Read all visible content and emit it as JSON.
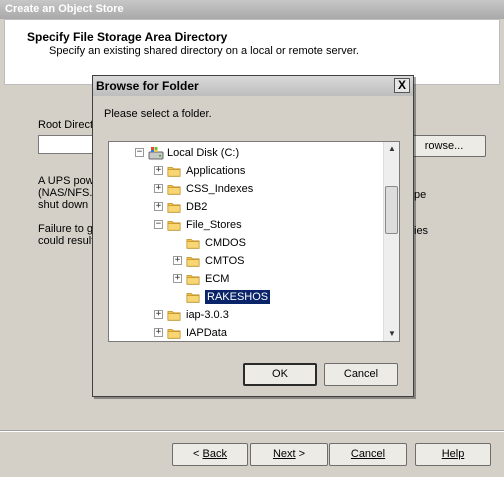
{
  "wizard": {
    "title": "Create an Object Store",
    "header_title": "Specify File Storage Area Directory",
    "header_subtitle": "Specify an existing shared directory on a local or remote server.",
    "root_label": "Root Direct",
    "root_value": "",
    "browse_label": "rowse...",
    "para1": [
      "A UPS pow",
      "(NAS/NFS.",
      "shut down"
    ],
    "para2": [
      "Failure to g",
      "could result"
    ],
    "frag1": "pe",
    "frag2": "ies",
    "buttons": {
      "back": "Back",
      "next": "Next",
      "cancel": "Cancel",
      "help": "Help"
    }
  },
  "dialog": {
    "title": "Browse for Folder",
    "close_glyph": "X",
    "prompt": "Please select a folder.",
    "ok_label": "OK",
    "cancel_label": "Cancel",
    "tree": [
      {
        "label": "Local Disk (C:)",
        "expander": "−",
        "kind": "drive"
      },
      {
        "label": "Applications",
        "expander": "+",
        "kind": "folder"
      },
      {
        "label": "CSS_Indexes",
        "expander": "+",
        "kind": "folder"
      },
      {
        "label": "DB2",
        "expander": "+",
        "kind": "folder"
      },
      {
        "label": "File_Stores",
        "expander": "−",
        "kind": "folder"
      },
      {
        "label": "CMDOS",
        "expander": "",
        "kind": "folder"
      },
      {
        "label": "CMTOS",
        "expander": "+",
        "kind": "folder"
      },
      {
        "label": "ECM",
        "expander": "+",
        "kind": "folder"
      },
      {
        "label": "RAKESHOS",
        "expander": "",
        "kind": "folder",
        "selected": true
      },
      {
        "label": "iap-3.0.3",
        "expander": "+",
        "kind": "folder"
      },
      {
        "label": "IAPData",
        "expander": "+",
        "kind": "folder"
      }
    ]
  },
  "colors": {
    "selection": "#0a246a",
    "folder": "#f2c24c"
  }
}
